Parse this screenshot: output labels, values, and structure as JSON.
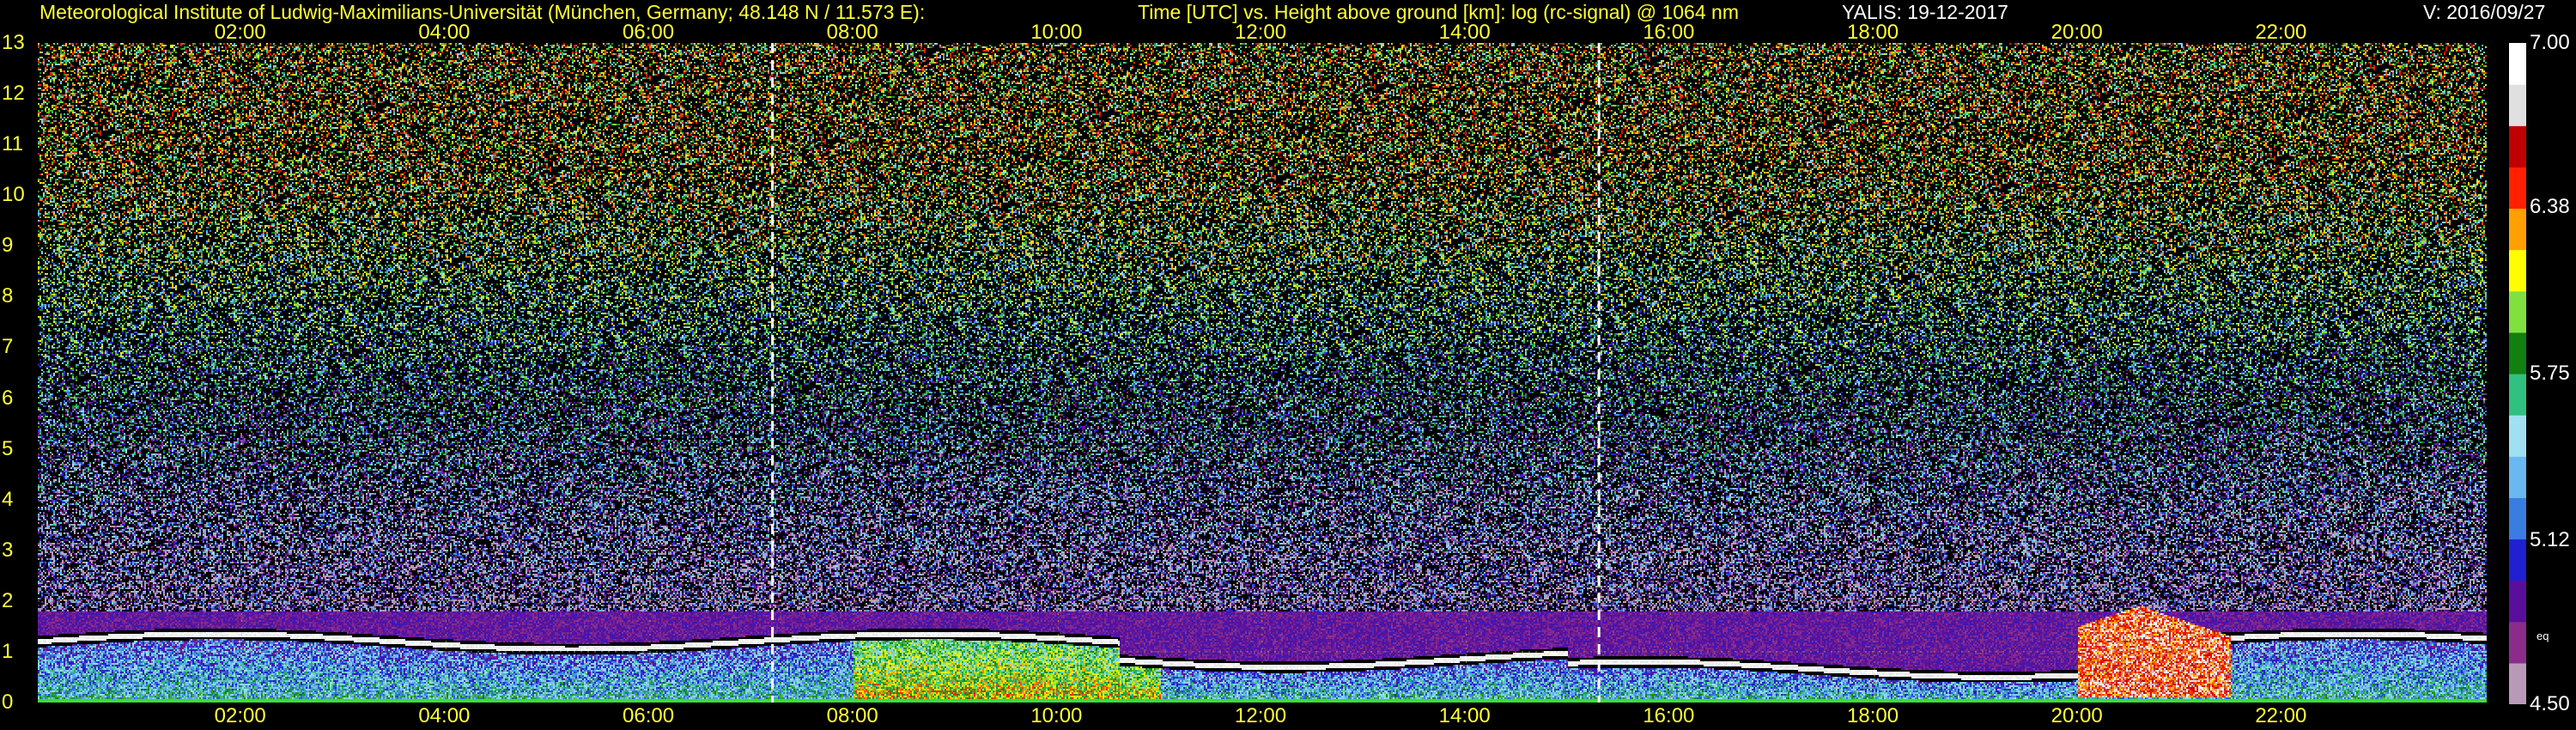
{
  "header": {
    "institute": "Meteorological Institute of Ludwig-Maximilians-Universität (München, Germany; 48.148 N / 11.573 E):",
    "axes_desc": "Time [UTC] vs. Height above ground [km]: log (rc-signal) @ 1064 nm",
    "station_date": "YALIS: 19-12-2017",
    "version": "V: 2016/09/27"
  },
  "chart_data": {
    "type": "heatmap",
    "x_axis": {
      "quantity": "Time [UTC]",
      "range_h": [
        0,
        24
      ],
      "ticks_h": [
        2,
        4,
        6,
        8,
        10,
        12,
        14,
        16,
        18,
        20,
        22
      ],
      "tick_labels": [
        "02:00",
        "04:00",
        "06:00",
        "08:00",
        "10:00",
        "12:00",
        "14:00",
        "16:00",
        "18:00",
        "20:00",
        "22:00"
      ]
    },
    "y_axis": {
      "quantity": "Height above ground [km]",
      "range": [
        0,
        13
      ],
      "tick_labels": [
        "0",
        "1",
        "2",
        "3",
        "4",
        "5",
        "6",
        "7",
        "8",
        "9",
        "10",
        "11",
        "12",
        "13"
      ]
    },
    "colorbar": {
      "quantity": "log (rc-signal)",
      "range": [
        4.5,
        7.0
      ],
      "tick_labels": [
        "4.50",
        "5.12",
        "5.75",
        "6.38",
        "7.00"
      ],
      "note": "eq",
      "colors_low_to_high": [
        "#b89ab8",
        "#8b2c8b",
        "#5a0f9a",
        "#2020d0",
        "#3a7de0",
        "#6ab8f0",
        "#a0e0f0",
        "#30c080",
        "#108010",
        "#80e040",
        "#ffff00",
        "#ffa000",
        "#ff2000",
        "#c00000",
        "#e0e0e0",
        "#ffffff"
      ]
    },
    "vertical_markers_h": [
      7.2,
      15.3
    ],
    "grid": true,
    "features": [
      {
        "name": "boundary layer top (bright band)",
        "height_km": 1.2
      },
      {
        "name": "dense aerosol / fog near surface",
        "height_km": [
          0,
          1.0
        ]
      },
      {
        "name": "low cloud after 20:00",
        "time_h": [
          20.0,
          21.5
        ],
        "height_km": [
          0.1,
          1.9
        ]
      }
    ]
  },
  "palette": {
    "label_yellow": "#ffff33",
    "grid_yellow": "#c8c800",
    "background": "#000000"
  }
}
